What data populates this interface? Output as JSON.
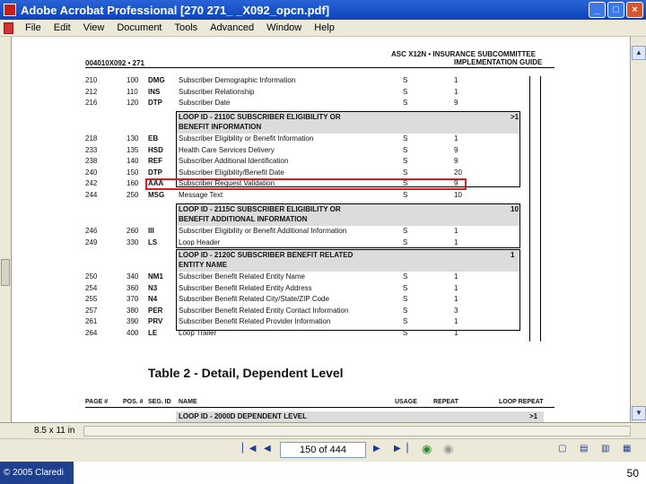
{
  "window": {
    "title": "Adobe Acrobat Professional   [270 271_ _X092_opcn.pdf]",
    "buttons": [
      "_",
      "□",
      "×"
    ]
  },
  "menu": [
    "File",
    "Edit",
    "View",
    "Document",
    "Tools",
    "Advanced",
    "Window",
    "Help"
  ],
  "page": {
    "header_left": "004010X092 • 271",
    "header_right_1": "ASC X12N • INSURANCE SUBCOMMITTEE",
    "header_right_2": "IMPLEMENTATION GUIDE",
    "rows_top": [
      {
        "page": "210",
        "pos": "100",
        "seg": "DMG",
        "name": "Subscriber Demographic Information",
        "usage": "S",
        "repeat": "1"
      },
      {
        "page": "212",
        "pos": "110",
        "seg": "INS",
        "name": "Subscriber Relationship",
        "usage": "S",
        "repeat": "1"
      },
      {
        "page": "216",
        "pos": "120",
        "seg": "DTP",
        "name": "Subscriber Date",
        "usage": "S",
        "repeat": "9"
      }
    ],
    "loop_2110c": {
      "title_1": "LOOP ID - 2110C  SUBSCRIBER ELIGIBILITY OR",
      "title_2": "BENEFIT INFORMATION",
      "repeat": ">1"
    },
    "rows_2110c": [
      {
        "page": "218",
        "pos": "130",
        "seg": "EB",
        "name": "Subscriber Eligibility or Benefit Information",
        "usage": "S",
        "repeat": "1"
      },
      {
        "page": "233",
        "pos": "135",
        "seg": "HSD",
        "name": "Health Care Services Delivery",
        "usage": "S",
        "repeat": "9"
      },
      {
        "page": "238",
        "pos": "140",
        "seg": "REF",
        "name": "Subscriber Additional Identification",
        "usage": "S",
        "repeat": "9"
      },
      {
        "page": "240",
        "pos": "150",
        "seg": "DTP",
        "name": "Subscriber Eligibility/Benefit Date",
        "usage": "S",
        "repeat": "20"
      },
      {
        "page": "242",
        "pos": "160",
        "seg": "AAA",
        "name": "Subscriber Request Validation",
        "usage": "S",
        "repeat": "9"
      },
      {
        "page": "244",
        "pos": "250",
        "seg": "MSG",
        "name": "Message Text",
        "usage": "S",
        "repeat": "10"
      }
    ],
    "loop_2115c": {
      "title_1": "LOOP ID - 2115C  SUBSCRIBER ELIGIBILITY OR",
      "title_2": "BENEFIT ADDITIONAL INFORMATION",
      "repeat": "10"
    },
    "rows_2115c": [
      {
        "page": "246",
        "pos": "260",
        "seg": "III",
        "name": "Subscriber Eligibility or Benefit Additional Information",
        "usage": "S",
        "repeat": "1"
      },
      {
        "page": "249",
        "pos": "330",
        "seg": "LS",
        "name": "Loop Header",
        "usage": "S",
        "repeat": "1"
      }
    ],
    "loop_2120c": {
      "title_1": "LOOP ID - 2120C  SUBSCRIBER BENEFIT RELATED",
      "title_2": "ENTITY NAME",
      "repeat": "1"
    },
    "rows_2120c": [
      {
        "page": "250",
        "pos": "340",
        "seg": "NM1",
        "name": "Subscriber Benefit Related Entity Name",
        "usage": "S",
        "repeat": "1"
      },
      {
        "page": "254",
        "pos": "360",
        "seg": "N3",
        "name": "Subscriber Benefit Related Entity Address",
        "usage": "S",
        "repeat": "1"
      },
      {
        "page": "255",
        "pos": "370",
        "seg": "N4",
        "name": "Subscriber Benefit Related City/State/ZIP Code",
        "usage": "S",
        "repeat": "1"
      },
      {
        "page": "257",
        "pos": "380",
        "seg": "PER",
        "name": "Subscriber Benefit Related Entity Contact Information",
        "usage": "S",
        "repeat": "3"
      },
      {
        "page": "261",
        "pos": "390",
        "seg": "PRV",
        "name": "Subscriber Benefit Related Provider Information",
        "usage": "S",
        "repeat": "1"
      },
      {
        "page": "264",
        "pos": "400",
        "seg": "LE",
        "name": "Loop Trailer",
        "usage": "S",
        "repeat": "1"
      }
    ],
    "table2_title": "Table 2 - Detail, Dependent Level",
    "columns": [
      "PAGE #",
      "POS. #",
      "SEG. ID",
      "NAME",
      "USAGE",
      "REPEAT",
      "LOOP REPEAT"
    ],
    "loop_2000d": {
      "title": "LOOP ID - 2000D  DEPENDENT LEVEL",
      "repeat": ">1"
    }
  },
  "status": {
    "page_size": "8.5 x 11 in"
  },
  "toolbar": {
    "page_field": "150 of 444"
  },
  "footer": {
    "copyright": "© 2005 Claredi",
    "slide_number": "50"
  }
}
